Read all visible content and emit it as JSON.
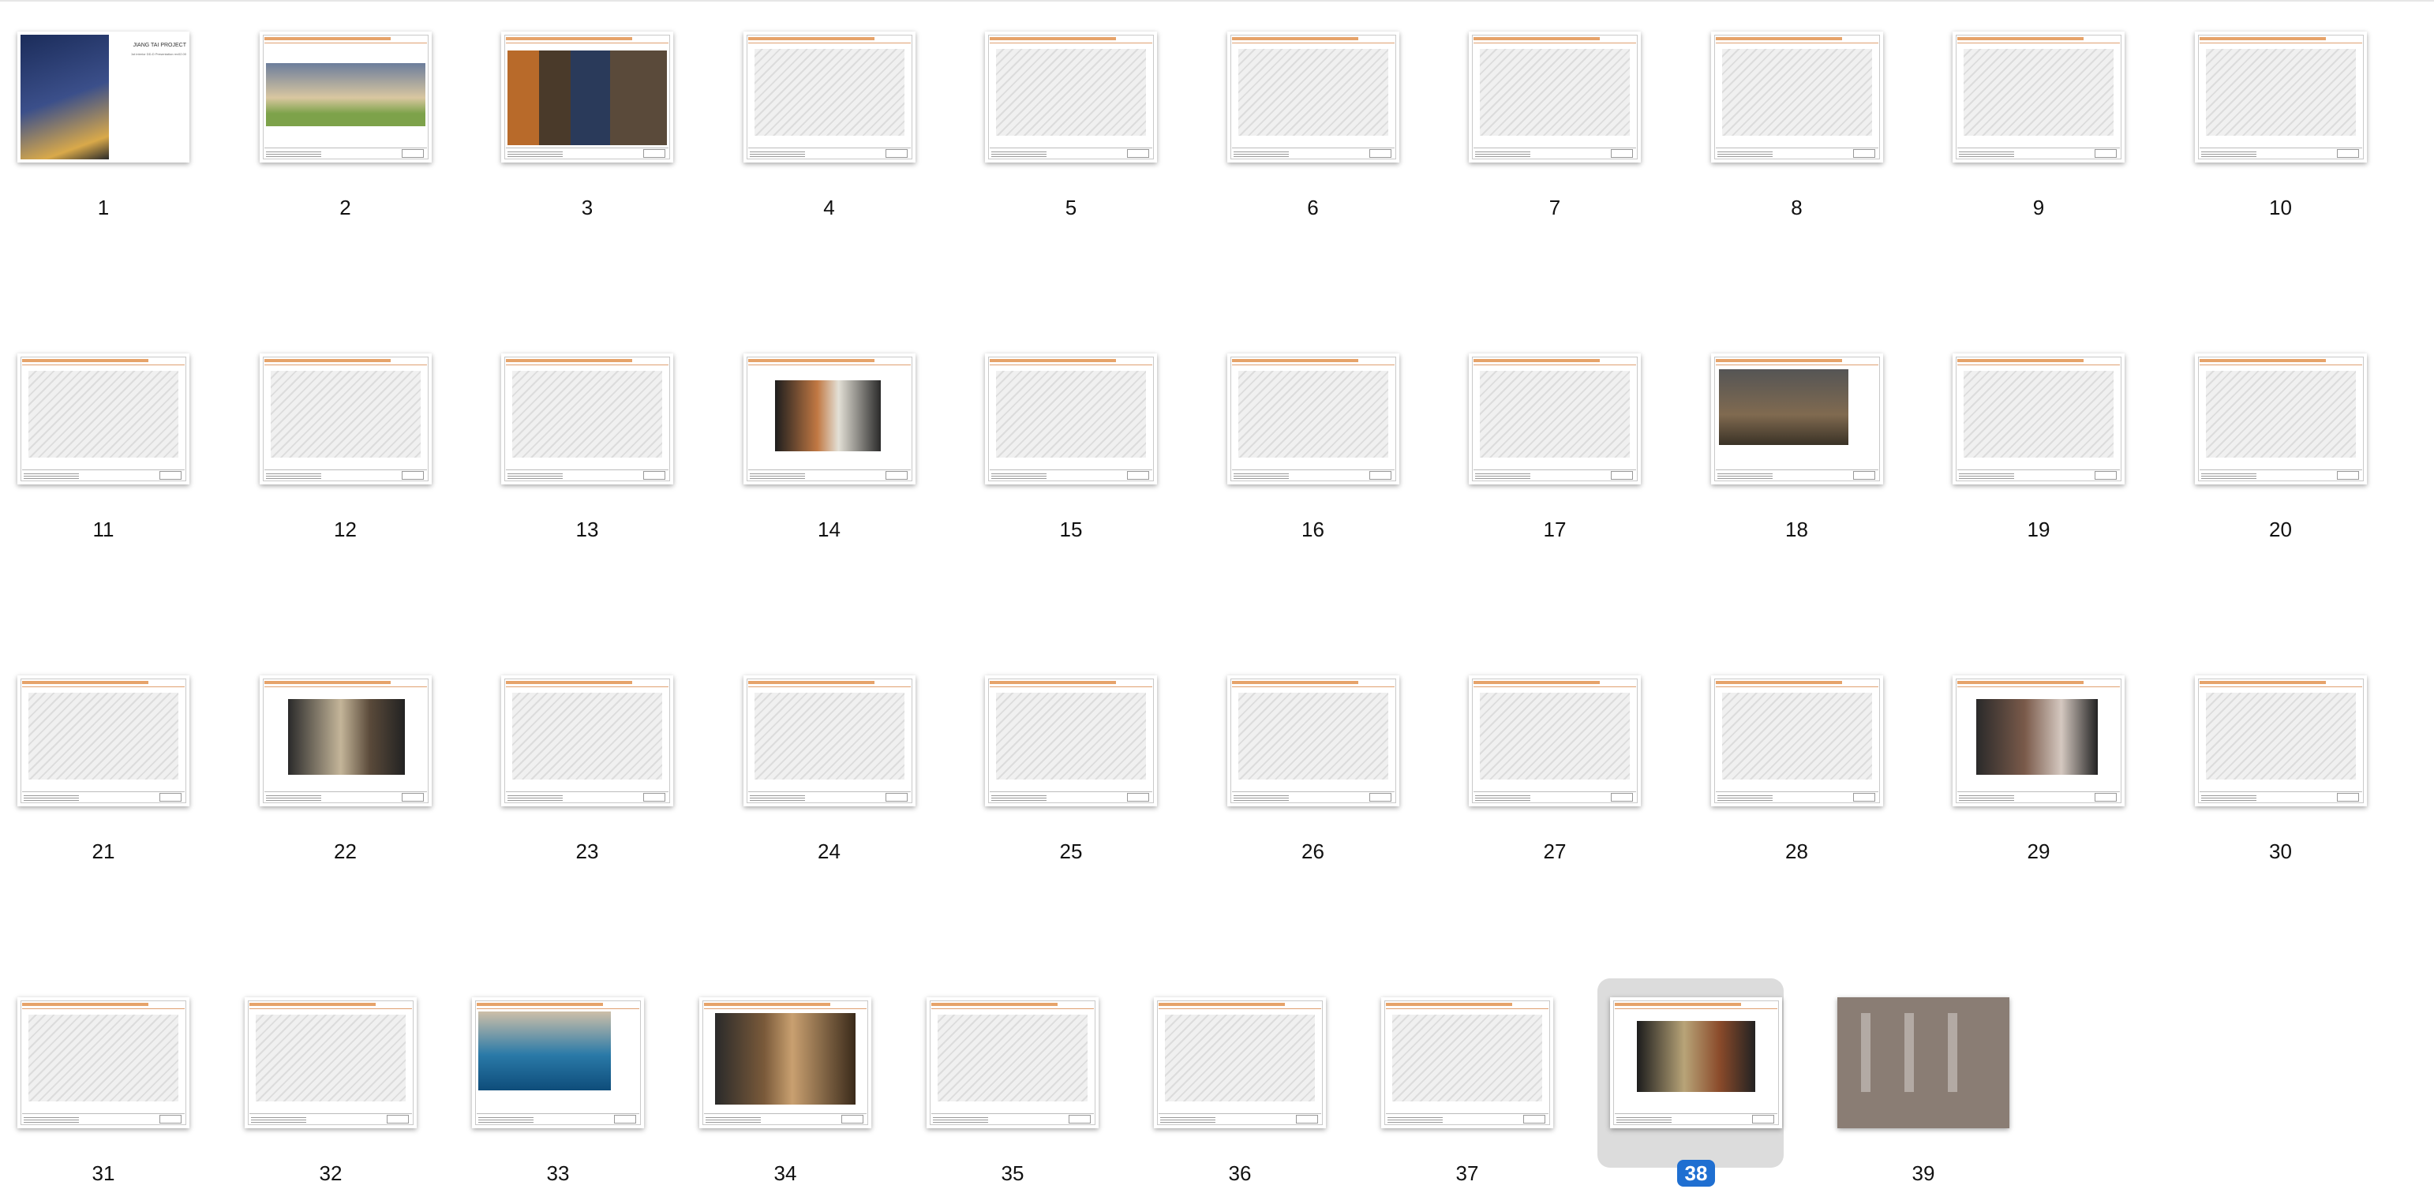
{
  "selected_page": "38",
  "pages": [
    {
      "number": "1",
      "cover": {
        "brand": "JIANG TAI PROJECT",
        "line1": "1st interior DD-D Presentation rev02.00"
      }
    },
    {
      "number": "2"
    },
    {
      "number": "3"
    },
    {
      "number": "4"
    },
    {
      "number": "5"
    },
    {
      "number": "6"
    },
    {
      "number": "7"
    },
    {
      "number": "8"
    },
    {
      "number": "9"
    },
    {
      "number": "10"
    },
    {
      "number": "11"
    },
    {
      "number": "12"
    },
    {
      "number": "13"
    },
    {
      "number": "14"
    },
    {
      "number": "15"
    },
    {
      "number": "16"
    },
    {
      "number": "17"
    },
    {
      "number": "18"
    },
    {
      "number": "19"
    },
    {
      "number": "20"
    },
    {
      "number": "21"
    },
    {
      "number": "22"
    },
    {
      "number": "23"
    },
    {
      "number": "24"
    },
    {
      "number": "25"
    },
    {
      "number": "26"
    },
    {
      "number": "27"
    },
    {
      "number": "28"
    },
    {
      "number": "29"
    },
    {
      "number": "30"
    },
    {
      "number": "31"
    },
    {
      "number": "32"
    },
    {
      "number": "33"
    },
    {
      "number": "34"
    },
    {
      "number": "35"
    },
    {
      "number": "36"
    },
    {
      "number": "37"
    },
    {
      "number": "38"
    },
    {
      "number": "39"
    }
  ],
  "colors": {
    "accent": "#1f6fd1",
    "slide_header": "#e6a36a",
    "selection_bg": "#dcdcdc"
  }
}
